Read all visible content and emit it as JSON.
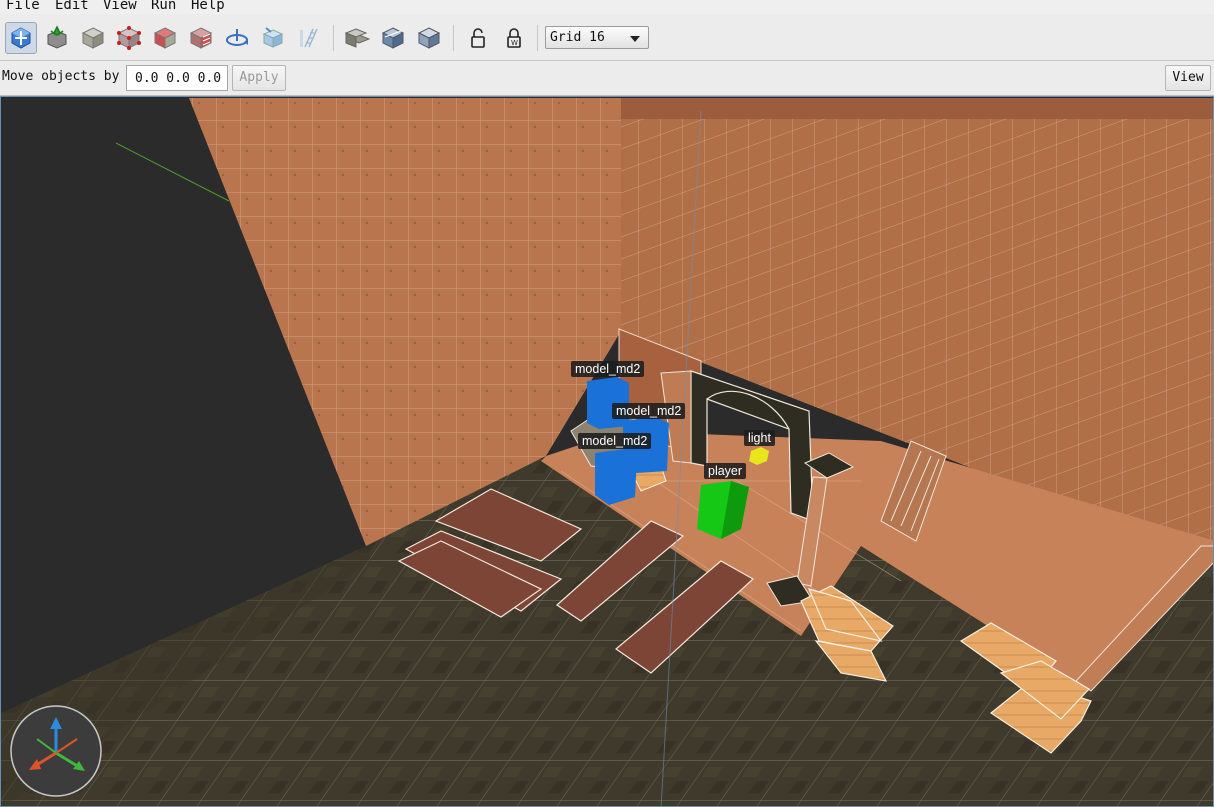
{
  "menu": [
    {
      "label": "File"
    },
    {
      "label": "Edit"
    },
    {
      "label": "View"
    },
    {
      "label": "Run"
    },
    {
      "label": "Help"
    }
  ],
  "toolbar": {
    "tools": [
      {
        "name": "select-move-icon",
        "active": true
      },
      {
        "name": "terrain-icon"
      },
      {
        "name": "cube-icon"
      },
      {
        "name": "vertex-edit-icon"
      },
      {
        "name": "face-select-icon"
      },
      {
        "name": "face-texture-icon"
      },
      {
        "name": "rotate-icon"
      },
      {
        "name": "texture-paint-icon"
      },
      {
        "name": "ruler-icon"
      },
      {
        "name": "clone-icon"
      },
      {
        "name": "stack-cube-icon"
      },
      {
        "name": "flip-cube-icon"
      },
      {
        "name": "lock-icon"
      },
      {
        "name": "unlock-w-icon"
      }
    ],
    "grid_label": "Grid 16"
  },
  "move": {
    "label": "Move objects by",
    "value": "0.0 0.0 0.0",
    "apply_label": "Apply"
  },
  "view_label": "View",
  "entities": [
    {
      "label": "model_md2",
      "color": "#1a72d8"
    },
    {
      "label": "model_md2",
      "color": "#1a72d8"
    },
    {
      "label": "model_md2",
      "color": "#1a72d8"
    },
    {
      "label": "light",
      "color": "#e7e51c"
    },
    {
      "label": "player",
      "color": "#16c816"
    }
  ],
  "colors": {
    "wall": "#b9754e",
    "floor": "#3f3a2b",
    "void": "#2b2b2b",
    "wood": "#e7a965",
    "plank": "#7d4535",
    "selection": "#6b8fb3"
  }
}
